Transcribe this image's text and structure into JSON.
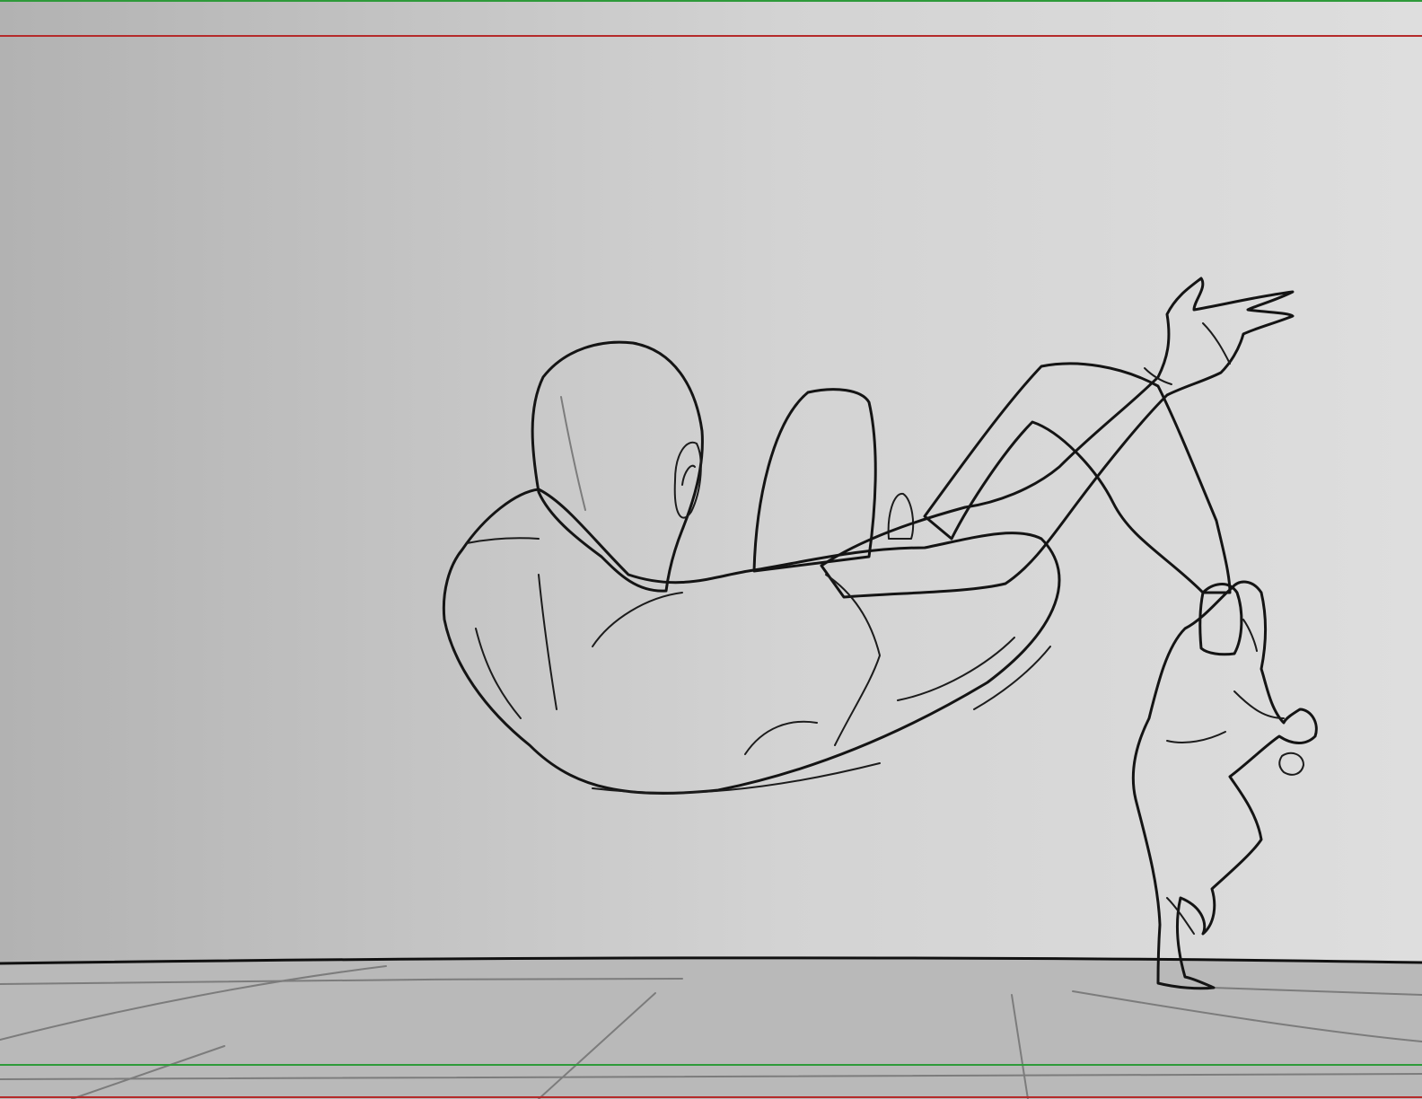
{
  "colors": {
    "wall_light": "#dcdcdc",
    "wall_dark": "#b4b4b4",
    "floor": "#b9b9b9",
    "figure_large": "#f0ebb2",
    "figure_small": "#5d7f98",
    "ink": "#141414",
    "safe_title_line": "#b52a2a",
    "safe_action_line": "#2e9a3a"
  }
}
